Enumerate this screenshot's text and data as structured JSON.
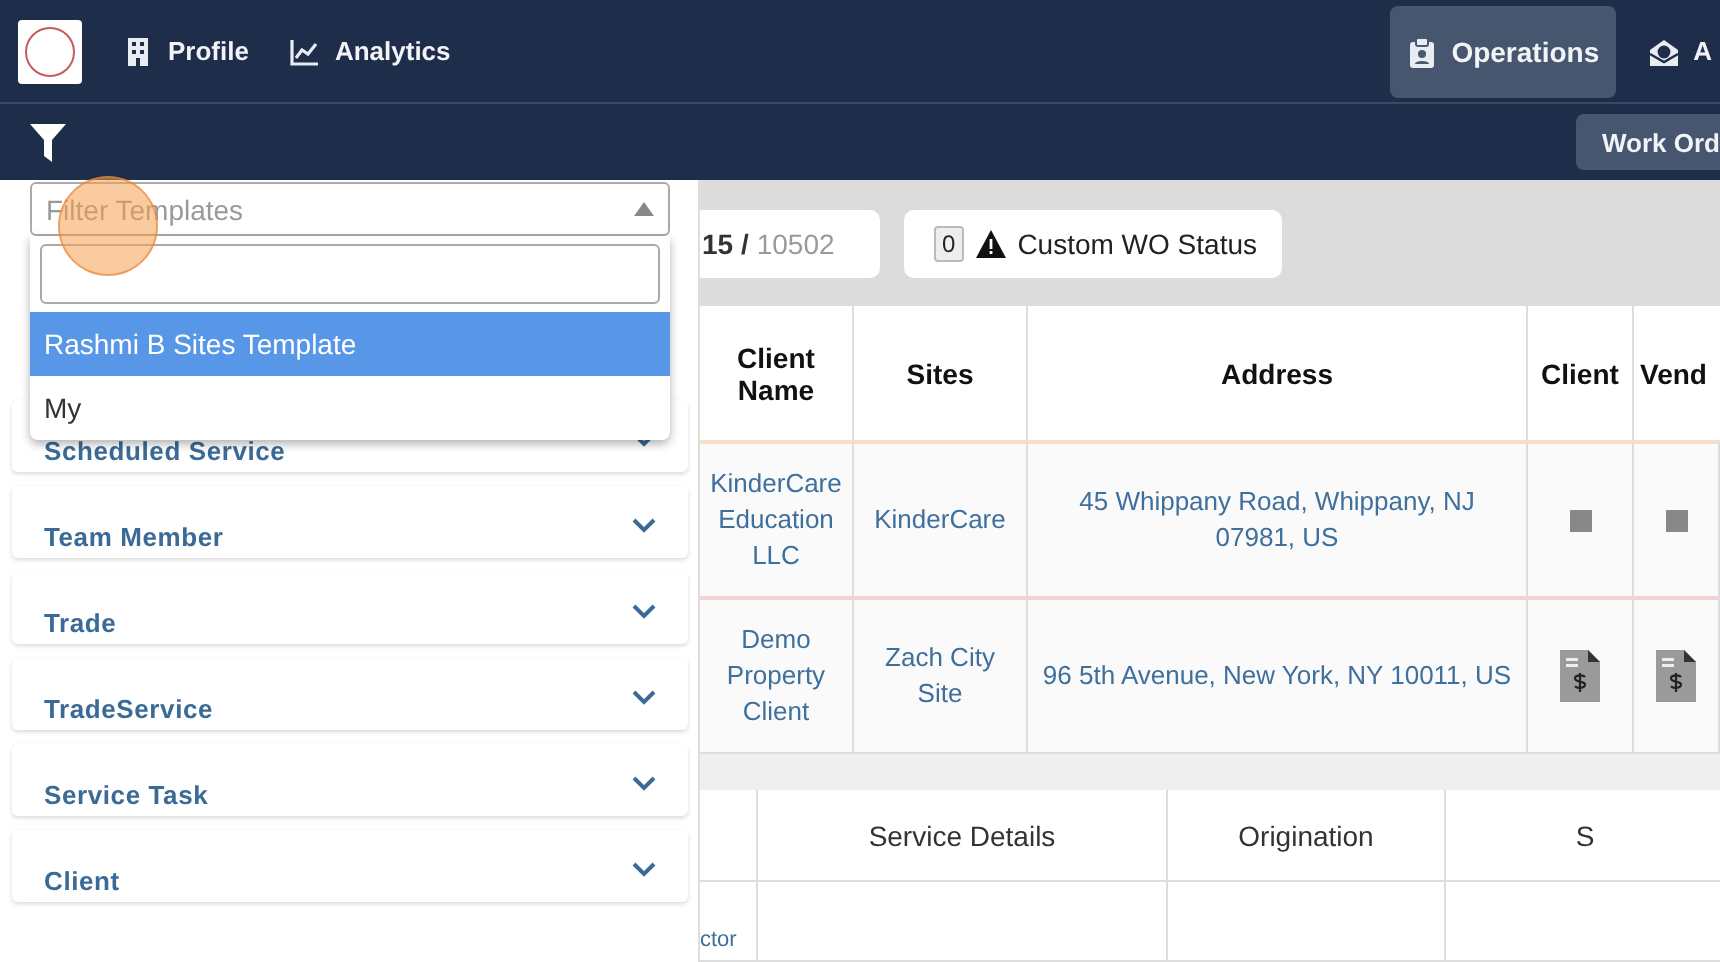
{
  "nav_left": [
    {
      "label": "Profile",
      "kind": "building",
      "selected": false
    },
    {
      "label": "Analytics",
      "kind": "chart",
      "selected": false
    }
  ],
  "nav_right": [
    {
      "label": "Operations",
      "kind": "clipboard",
      "selected": true
    },
    {
      "label": "A",
      "kind": "money",
      "selected": false
    }
  ],
  "work_orders_button": "Work Ord",
  "filters": {
    "template_select": {
      "placeholder": "Filter Templates",
      "expanded": true
    },
    "options": [
      {
        "label": "Rashmi B Sites Template",
        "selected": true
      },
      {
        "label": "My",
        "selected": false
      }
    ],
    "sections": [
      {
        "label": "Scheduled Service"
      },
      {
        "label": "Team Member"
      },
      {
        "label": "Trade"
      },
      {
        "label": "TradeService"
      },
      {
        "label": "Service Task"
      },
      {
        "label": "Client"
      }
    ]
  },
  "stats": {
    "count": "15",
    "divider": "/",
    "total": "10502"
  },
  "status_button": {
    "count": "0",
    "label": "Custom WO Status"
  },
  "table": {
    "columns": [
      "Client Name",
      "Sites",
      "Address",
      "Client",
      "Vend"
    ],
    "rows": [
      {
        "color": "#f5dfc6",
        "cells": [
          "KinderCare Education LLC",
          "KinderCare",
          "45 Whippany Road, Whippany, NJ 07981, US"
        ],
        "icons": [
          {
            "kind": "square"
          },
          {
            "kind": "square"
          }
        ]
      },
      {
        "color": "#f3d3d3",
        "cells": [
          "Demo Property Client",
          "Zach City Site",
          "96 5th Avenue, New York, NY 10011, US"
        ],
        "icons": [
          {
            "kind": "invoice"
          },
          {
            "kind": "invoice"
          }
        ]
      }
    ]
  },
  "details_table": {
    "columns": [
      "Service Details",
      "Origination",
      "S"
    ],
    "cells": [
      "ctor"
    ]
  }
}
